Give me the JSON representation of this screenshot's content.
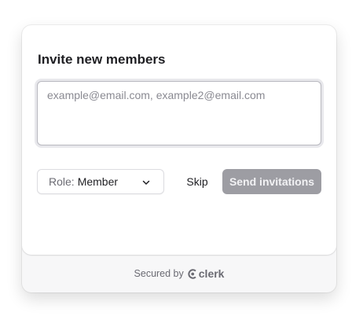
{
  "dialog": {
    "title": "Invite new members",
    "email_placeholder": "example@email.com, example2@email.com",
    "email_value": ""
  },
  "role": {
    "prefix": "Role:",
    "value": "Member"
  },
  "actions": {
    "skip_label": "Skip",
    "send_label": "Send invitations"
  },
  "footer": {
    "secured_by": "Secured by",
    "brand": "clerk"
  },
  "icons": {
    "role_chevron": "chevron-down-icon",
    "brand_logo": "clerk-logo-icon"
  },
  "colors": {
    "send_button_disabled_bg": "#9d9da3",
    "card_bg": "#ffffff",
    "footer_bg": "#f7f7f8",
    "text_primary": "#1f1f23",
    "text_muted": "#6b6b73"
  }
}
